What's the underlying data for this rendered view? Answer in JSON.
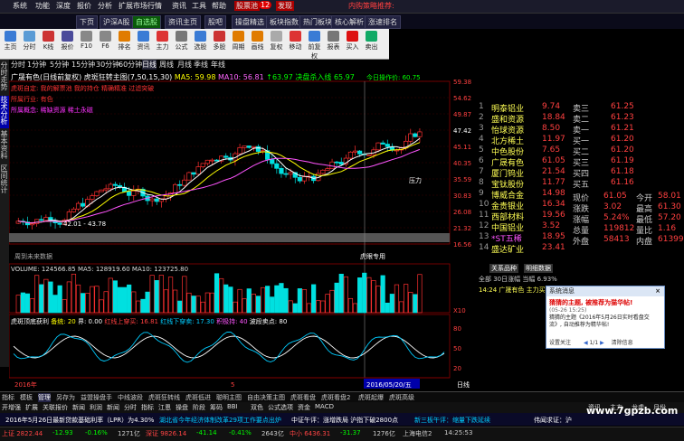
{
  "menu": {
    "items": [
      "系统",
      "功能",
      "深度",
      "报价",
      "分析",
      "扩展市场行情",
      "资讯",
      "工具",
      "帮助"
    ],
    "pills": [
      "股票池",
      "发现"
    ],
    "badge": "12",
    "right_text": "内购策略推荐:"
  },
  "nav": {
    "tabs": [
      "下页",
      "沪深A股",
      "自选股",
      "资讯主页",
      "股吧",
      "操盘精选",
      "板块指数",
      "热门板块",
      "核心解析",
      "涨速排名"
    ],
    "active_index": 2
  },
  "toolbar": {
    "buttons": [
      {
        "label": "主页",
        "icon": "home-icon",
        "color": "#3a7bd5"
      },
      {
        "label": "分时",
        "icon": "timeshare-icon",
        "color": "#5a9bd5"
      },
      {
        "label": "K线",
        "icon": "kline-icon",
        "color": "#c33"
      },
      {
        "label": "报价",
        "icon": "quote-icon",
        "color": "#4a4a9a"
      },
      {
        "label": "F10",
        "icon": "f10-icon",
        "color": "#888"
      },
      {
        "label": "F6",
        "icon": "f6-icon",
        "color": "#888"
      },
      {
        "label": "排名",
        "icon": "rank-icon",
        "color": "#e07b00"
      },
      {
        "label": "资讯",
        "icon": "news-icon",
        "color": "#3a7bd5"
      },
      {
        "label": "主力",
        "icon": "main-force-icon",
        "color": "#d33"
      },
      {
        "label": "公式",
        "icon": "formula-icon",
        "color": "#777"
      },
      {
        "label": "选股",
        "icon": "stock-pick-icon",
        "color": "#3a7bd5"
      },
      {
        "label": "多股",
        "icon": "multi-stock-icon",
        "color": "#c33"
      },
      {
        "label": "周期",
        "icon": "period-icon",
        "color": "#e07b00"
      },
      {
        "label": "画线",
        "icon": "draw-line-icon",
        "color": "#e07b00"
      },
      {
        "label": "复权",
        "icon": "fuquan-icon",
        "color": "#aaa"
      },
      {
        "label": "移动",
        "icon": "move-icon",
        "color": "#d33"
      },
      {
        "label": "前复权",
        "icon": "front-fuquan-icon",
        "color": "#3a7bd5"
      },
      {
        "label": "报表",
        "icon": "report-icon",
        "color": "#777"
      },
      {
        "label": "买入",
        "icon": "buy-icon",
        "color": "#d11"
      },
      {
        "label": "卖出",
        "icon": "sell-icon",
        "color": "#1a6"
      }
    ]
  },
  "periods": [
    "分时",
    "1分钟",
    "5分钟",
    "15分钟",
    "30分钟",
    "60分钟",
    "日线",
    "周线",
    "月线",
    "季线",
    "年线"
  ],
  "side_tabs": [
    "分时走势",
    "技术分析",
    "基本资料",
    "区间统计"
  ],
  "chart": {
    "header": {
      "title": "广晟有色(日线前复权)",
      "indicator": "虎斑狂转主图(7,50,15,30)",
      "ma5": "MA5: 59.98",
      "ma10": "MA10: 56.81",
      "extra": "↑63.97 决盘杀入线 65.97",
      "right_text": "今日操作价: 60.75"
    },
    "annot": [
      {
        "text": "虎斑自定: 我的解票池 我的持仓 精确精准 过滤突破",
        "color": "#ff3333"
      },
      {
        "text": "所属行业: 有色",
        "color": "#ff3333"
      },
      {
        "text": "所属概念: 稀缺资源 稀土永磁",
        "color": "#ff33ff"
      }
    ],
    "price_labels": [
      "59.38",
      "54.62",
      "49.87",
      "47.42",
      "45.11",
      "40.35",
      "35.59",
      "30.83",
      "26.08",
      "21.32",
      "16.56"
    ],
    "price_pressure": "压力",
    "low_label": "42.01 - 43.78",
    "future_label": "周到未来数据",
    "tiger_label": "虎眼专用",
    "volume_header": "VOLUME: 124566.85  MA5: 128919.60  MA10: 123725.80",
    "volume_labels": [
      "X10"
    ],
    "osc_header": {
      "name": "虎斑顶底获利",
      "buy": "备统: 20",
      "boundary": "界: 0.00",
      "redline": "红线上穿买: 16.81",
      "redline_down": "红线下穿卖: 17.30",
      "hold": "积极持: 40",
      "sell": "波段卖点: 80"
    },
    "osc_labels": [
      "80",
      "50",
      "20"
    ],
    "date_start": "2016年",
    "date_mid": "5",
    "date_end": "2016/05/20/五",
    "axis_period": "日线"
  },
  "quote": {
    "sells": [
      {
        "label": "卖三",
        "price": "61.25"
      },
      {
        "label": "卖二",
        "price": "61.23"
      },
      {
        "label": "卖一",
        "price": "61.21"
      },
      {
        "label": "买一",
        "price": "61.20"
      },
      {
        "label": "买二",
        "price": "61.20"
      },
      {
        "label": "买三",
        "price": "61.19"
      },
      {
        "label": "买四",
        "price": "61.18"
      },
      {
        "label": "买五",
        "price": "61.16"
      }
    ],
    "stats": [
      {
        "k": "现价",
        "v": "61.05",
        "k2": "今开",
        "v2": "58.01"
      },
      {
        "k": "涨跌",
        "v": "3.02",
        "k2": "最高",
        "v2": "61.30"
      },
      {
        "k": "涨幅",
        "v": "5.24%",
        "k2": "最低",
        "v2": "57.20"
      },
      {
        "k": "总量",
        "v": "119812",
        "k2": "量比",
        "v2": "1.16"
      },
      {
        "k": "外盘",
        "v": "58413",
        "k2": "内盘",
        "v2": "61399"
      }
    ],
    "list": [
      {
        "name": "明泰铝业",
        "value": "9.74"
      },
      {
        "name": "盛和资源",
        "value": "18.84"
      },
      {
        "name": "怡球资源",
        "value": "8.50"
      },
      {
        "name": "北方稀土",
        "value": "11.97"
      },
      {
        "name": "中色股份",
        "value": "7.65"
      },
      {
        "name": "广晟有色",
        "value": "61.05"
      },
      {
        "name": "厦门钨业",
        "value": "21.54"
      },
      {
        "name": "宝钛股份",
        "value": "11.77"
      },
      {
        "name": "博威合金",
        "value": "14.98"
      },
      {
        "name": "金贵银业",
        "value": "16.34"
      },
      {
        "name": "西部材料",
        "value": "19.56"
      },
      {
        "name": "中国铝业",
        "value": "3.52"
      },
      {
        "name": "*ST五稀",
        "value": "18.95"
      },
      {
        "name": "盛达矿业",
        "value": "23.41"
      }
    ],
    "tabs": [
      "关系品种",
      "明细数据"
    ],
    "summary": "全部 30日涨幅  当幅 6.93%",
    "minute_ticker": "14:24 广晟有色  主力买入"
  },
  "popup": {
    "title": "系统消息",
    "close": "×",
    "headline": "猜猜的主题, 被推荐为猫华帖!",
    "time": "(05-26 15:25)",
    "body": "猜猜的主题《2016年5月26日实时看盘交流》, 自动推荐为精华帖!",
    "settings": "设置关注",
    "page": "1/1",
    "clear": "清除信息"
  },
  "bottom_tabs": [
    "指标",
    "模板",
    "管理",
    "另存为",
    "益盟操盘手",
    "中线波段",
    "虎斑狂转线",
    "虎斑低进",
    "聪明主图",
    "自由决策主图",
    "虎斑看盘",
    "虎斑看盘2",
    "虎斑起爆",
    "虎斑高级"
  ],
  "bottom_tabs_active": 2,
  "toolbar2": {
    "items": [
      "开增强",
      "扩展",
      "关联报价",
      "新闻",
      "利润",
      "新闻",
      "分时",
      "指标",
      "江恩",
      "操盘",
      "阶段",
      "筹码",
      "BBI",
      "双色",
      "公式选项",
      "资金",
      "MACD"
    ],
    "right": [
      "资讯",
      "主力",
      "龙虎",
      "月份"
    ]
  },
  "ticker": {
    "items": [
      {
        "text": "2016年5月26日最新贷款基础利率（LPR）为4.30%",
        "color": "#ffffff"
      },
      {
        "text": "湖北省今年经济体制改革29项工作要点出炉",
        "color": "#00ccff"
      },
      {
        "text": "中证午评：涨增跌局 沪指下破2800点",
        "color": "#ffffff"
      },
      {
        "text": "新三板午评：缩量下跌延续",
        "color": "#00ccff"
      },
      {
        "text": "伟闻求证：沪",
        "color": "#ffffff"
      }
    ]
  },
  "status": {
    "items": [
      {
        "label": "上证",
        "value": "2822.44",
        "color": "#ff4444"
      },
      {
        "label": "",
        "value": "-12.93",
        "color": "#00ff00"
      },
      {
        "label": "",
        "value": "-0.16%",
        "color": "#00ff00"
      },
      {
        "label": "",
        "value": "1271亿",
        "color": "#cccccc"
      },
      {
        "label": "深证",
        "value": "9826.14",
        "color": "#ff4444"
      },
      {
        "label": "",
        "value": "-41.14",
        "color": "#00ff00"
      },
      {
        "label": "",
        "value": "-0.41%",
        "color": "#00ff00"
      },
      {
        "label": "",
        "value": "2643亿",
        "color": "#cccccc"
      },
      {
        "label": "中小",
        "value": "6436.31",
        "color": "#ff4444"
      },
      {
        "label": "",
        "value": "-31.37",
        "color": "#00ff00"
      },
      {
        "label": "",
        "value": "1276亿",
        "color": "#cccccc"
      }
    ],
    "server": "上海电信2",
    "time": "14:25:53",
    "watermark": "www.7gpzb.com"
  }
}
